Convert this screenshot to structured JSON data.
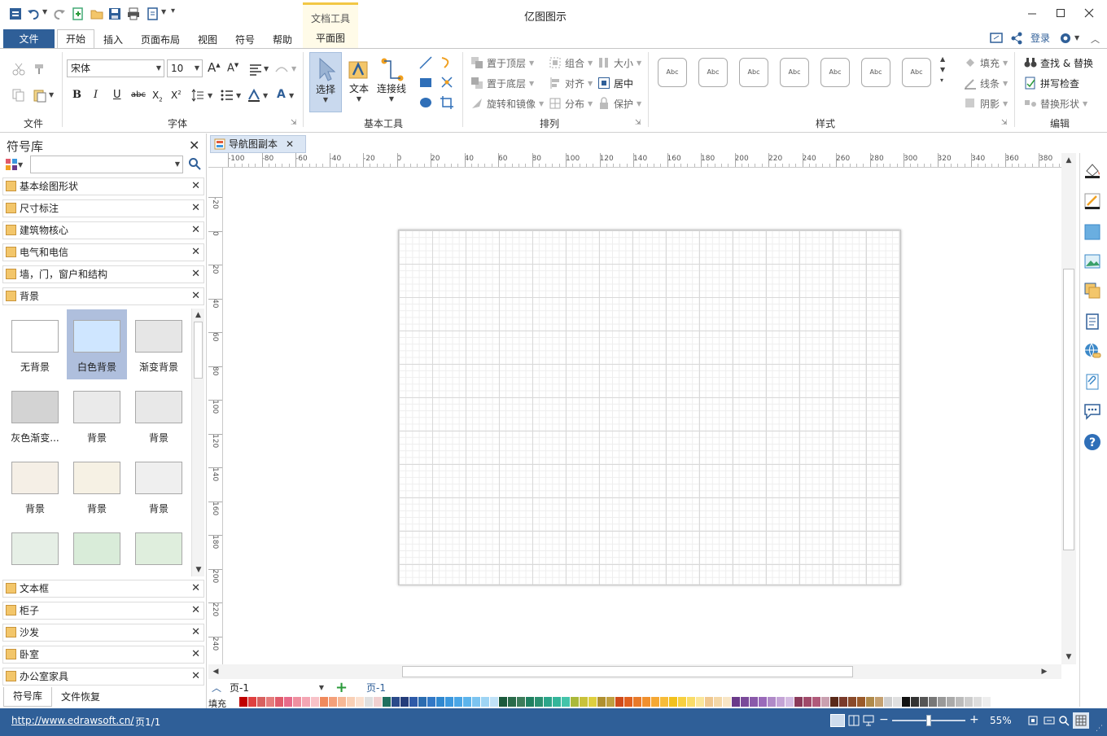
{
  "app": {
    "title": "亿图图示"
  },
  "menu": {
    "file": "文件",
    "home": "开始",
    "insert": "插入",
    "page_layout": "页面布局",
    "view": "视图",
    "symbols": "符号",
    "help": "帮助",
    "context_group": "文档工具",
    "context_tab": "平面图"
  },
  "header_right": {
    "login": "登录"
  },
  "ribbon": {
    "groups": {
      "file": "文件",
      "font": "字体",
      "basic_tools": "基本工具",
      "arrange": "排列",
      "styles": "样式",
      "edit": "编辑"
    },
    "font": {
      "name": "宋体",
      "size": "10"
    },
    "tools": {
      "select": "选择",
      "text": "文本",
      "connector": "连接线"
    },
    "arrange": {
      "bring_front": "置于顶层",
      "send_back": "置于底层",
      "rotate_mirror": "旋转和镜像",
      "group": "组合",
      "align": "对齐",
      "distribute": "分布",
      "size": "大小",
      "center": "居中",
      "protect": "保护"
    },
    "style_sample": "Abc",
    "style_props": {
      "fill": "填充",
      "line": "线条",
      "shadow": "阴影",
      "replace_shape": "替换形状"
    },
    "edit": {
      "find_replace": "查找 & 替换",
      "spell_check": "拼写检查"
    }
  },
  "library": {
    "title": "符号库",
    "search_value": "",
    "top_categories": [
      "基本绘图形状",
      "尺寸标注",
      "建筑物核心",
      "电气和电信",
      "墙，门，窗户和结构",
      "背景"
    ],
    "shapes": [
      {
        "label": "无背景",
        "color": "#ffffff"
      },
      {
        "label": "白色背景",
        "color": "#cfe6ff"
      },
      {
        "label": "渐变背景",
        "color": "#e6e6e6"
      },
      {
        "label": "灰色渐变...",
        "color": "#d3d3d3"
      },
      {
        "label": "背景",
        "color": "#eaeaea"
      },
      {
        "label": "背景",
        "color": "#e8e8e8"
      },
      {
        "label": "背景",
        "color": "#f5efe6"
      },
      {
        "label": "背景",
        "color": "#f6f1e4"
      },
      {
        "label": "背景",
        "color": "#efefef"
      },
      {
        "label": "",
        "color": "#e6efe6"
      },
      {
        "label": "",
        "color": "#d9ecd9"
      },
      {
        "label": "",
        "color": "#dfeedd"
      }
    ],
    "bottom_categories": [
      "文本框",
      "柜子",
      "沙发",
      "卧室",
      "办公室家具"
    ],
    "tabs": [
      "符号库",
      "文件恢复"
    ]
  },
  "document": {
    "tab": "导航图副本",
    "page_name": "页-1",
    "page_tab": "页-1"
  },
  "ruler": {
    "h_labels": [
      "-100",
      "-80",
      "-60",
      "-40",
      "-20",
      "0",
      "20",
      "40",
      "60",
      "80",
      "100",
      "120",
      "140",
      "160",
      "180",
      "200",
      "220",
      "240",
      "260",
      "280",
      "300",
      "320",
      "340",
      "360",
      "380"
    ],
    "v_labels": [
      "-20",
      "0",
      "20",
      "40",
      "60",
      "80",
      "100",
      "120",
      "140",
      "160",
      "180",
      "200",
      "220",
      "240"
    ]
  },
  "palette": {
    "label": "填充",
    "colors": [
      "#ffffff",
      "#c00000",
      "#e04040",
      "#d8605f",
      "#e57c7c",
      "#e05a6a",
      "#e76a8a",
      "#ef8fa0",
      "#f4a6b4",
      "#f8c2c8",
      "#f08a5d",
      "#f4a07a",
      "#f6b896",
      "#f9d0b6",
      "#fbe1d0",
      "#e0e0e0",
      "#f0d0d0",
      "#1f6f5f",
      "#2a4a8a",
      "#243c7a",
      "#2e5aa8",
      "#2b6cb0",
      "#3178c6",
      "#2f88d0",
      "#3b98de",
      "#4aa6e6",
      "#5cb4ec",
      "#7cc4f0",
      "#9ed4f4",
      "#c0e2f8",
      "#1c5a3c",
      "#2a6b4a",
      "#3c7c5a",
      "#1f8060",
      "#2a9070",
      "#2ca58a",
      "#33b59a",
      "#44c4aa",
      "#aab93a",
      "#c9c23a",
      "#dfcf3e",
      "#b09030",
      "#c0a040",
      "#d04a1a",
      "#e06020",
      "#e87a2a",
      "#f0902e",
      "#f5a834",
      "#f7bc3a",
      "#f2c11d",
      "#f7d040",
      "#f9dc68",
      "#fbe69a",
      "#f0c890",
      "#f4d8a8",
      "#f8e6c6",
      "#6a3a8a",
      "#7a4a9a",
      "#8a5aaa",
      "#9a6aba",
      "#b08ac8",
      "#c4a4d6",
      "#d4bce2",
      "#8a3a5a",
      "#a04a6a",
      "#b05a7a",
      "#c9a0b0",
      "#5a2a1a",
      "#7a3a2a",
      "#8a4a2a",
      "#9a5a2a",
      "#b08a4a",
      "#c4a070",
      "#cfcfcf",
      "#e0e0e0",
      "#111111",
      "#333333",
      "#555555",
      "#777777",
      "#999999",
      "#aaaaaa",
      "#bbbbbb",
      "#cccccc",
      "#dddddd",
      "#eeeeee"
    ]
  },
  "status": {
    "url": "http://www.edrawsoft.cn/",
    "page_info": "页1/1",
    "zoom": "55%",
    "zoom_fraction": 0.5
  }
}
